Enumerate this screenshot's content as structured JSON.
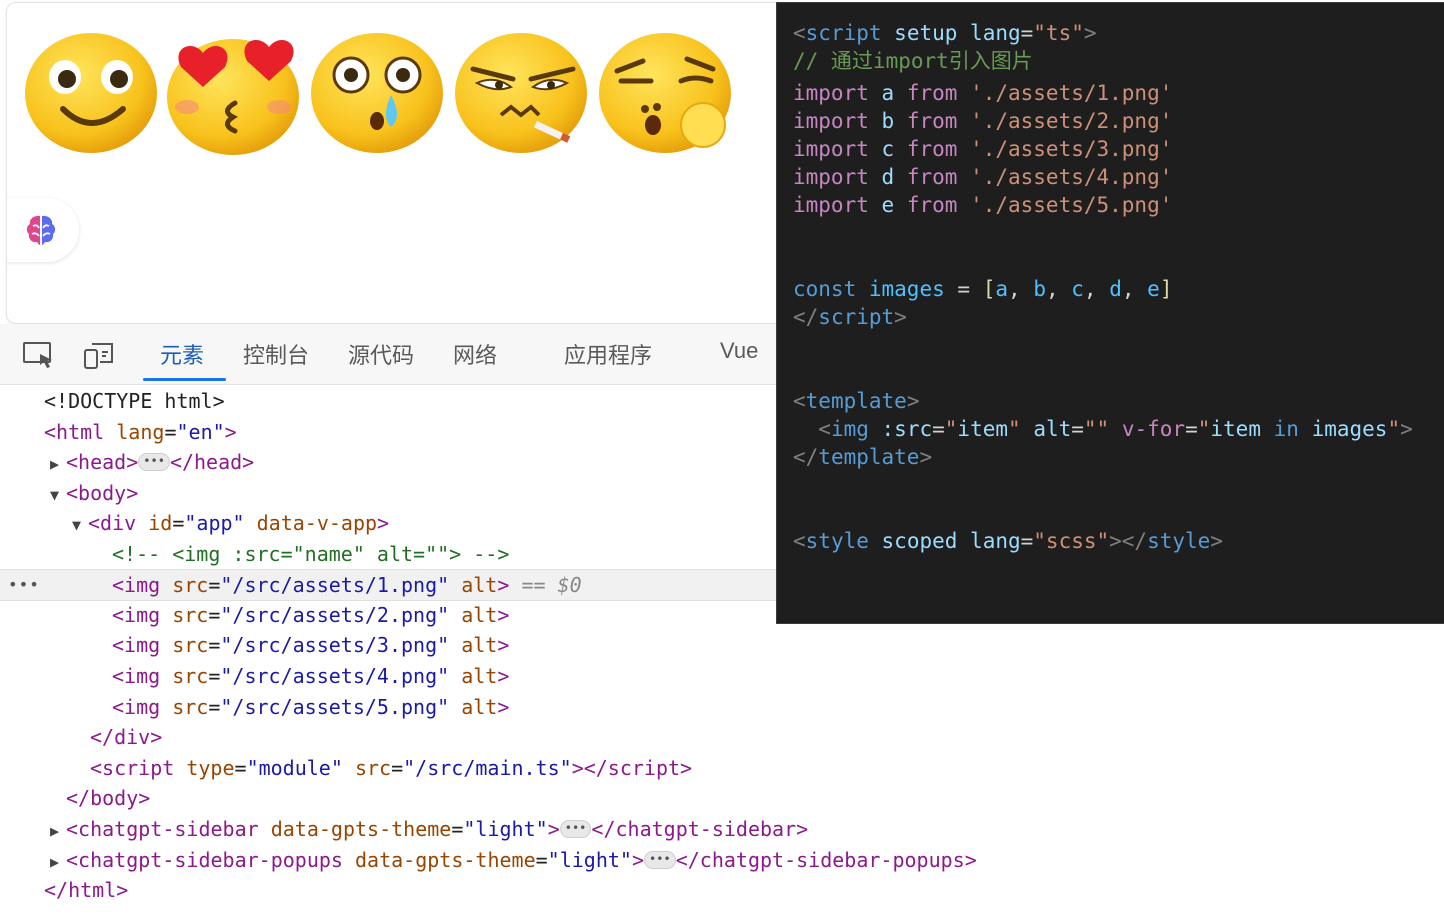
{
  "preview": {
    "emojis": [
      {
        "name": "smile-emoji"
      },
      {
        "name": "heart-eyes-kiss-emoji"
      },
      {
        "name": "crying-surprised-emoji"
      },
      {
        "name": "smoking-smirk-emoji"
      },
      {
        "name": "thinking-emoji"
      }
    ]
  },
  "devtools": {
    "tabs": [
      "元素",
      "控制台",
      "源代码",
      "网络",
      "应用程序",
      "Vue"
    ],
    "active_tab": "元素",
    "dom": {
      "doctype": "<!DOCTYPE html>",
      "html_open": "<html",
      "html_lang_attr": "lang",
      "html_lang_val": "\"en\"",
      "head_open": "<head>",
      "head_close": "</head>",
      "body_open": "<body>",
      "div_open": "<div",
      "div_id_attr": "id",
      "div_id_val": "\"app\"",
      "div_extra_attr": "data-v-app",
      "comment": "<!-- <img :src=\"name\" alt=\"\"> -->",
      "img_rows": [
        {
          "src": "\"/src/assets/1.png\""
        },
        {
          "src": "\"/src/assets/2.png\""
        },
        {
          "src": "\"/src/assets/3.png\""
        },
        {
          "src": "\"/src/assets/4.png\""
        },
        {
          "src": "\"/src/assets/5.png\""
        }
      ],
      "selected_ref": "== $0",
      "div_close": "</div>",
      "script_type_val": "\"module\"",
      "script_src_val": "\"/src/main.ts\"",
      "body_close": "</body>",
      "sidebar_tag": "chatgpt-sidebar",
      "sidebar_attr": "data-gpts-theme",
      "sidebar_val": "\"light\"",
      "popups_tag": "chatgpt-sidebar-popups",
      "html_close": "</html>"
    }
  },
  "code": {
    "script_open_tag": "script",
    "setup": "setup",
    "lang_attr": "lang",
    "lang_val": "\"ts\"",
    "comment": "// 通过import引入图片",
    "imports": [
      {
        "name": "a",
        "path": "'./assets/1.png'"
      },
      {
        "name": "b",
        "path": "'./assets/2.png'"
      },
      {
        "name": "c",
        "path": "'./assets/3.png'"
      },
      {
        "name": "d",
        "path": "'./assets/4.png'"
      },
      {
        "name": "e",
        "path": "'./assets/5.png'"
      }
    ],
    "const_kw": "const",
    "images_var": "images",
    "array": [
      "a",
      "b",
      "c",
      "d",
      "e"
    ],
    "script_close": "script",
    "template_tag": "template",
    "img_src_attr": ":src",
    "img_src_val": "\"item\"",
    "img_alt_attr": "alt",
    "img_alt_val": "\"\"",
    "vfor_attr": "v-for",
    "vfor_item": "item",
    "vfor_in": "in",
    "vfor_images": "images",
    "style_tag": "style",
    "scoped": "scoped",
    "style_lang_val": "\"scss\""
  }
}
